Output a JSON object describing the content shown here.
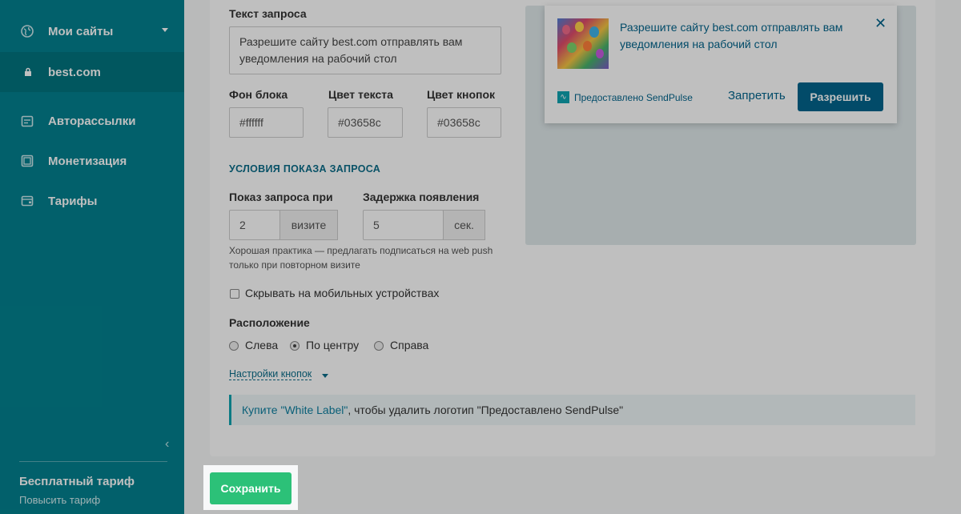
{
  "sidebar": {
    "items": [
      {
        "label": "Мои сайты",
        "icon": "globe-icon"
      },
      {
        "label": "best.com",
        "icon": "lock-icon"
      },
      {
        "label": "Авторассылки",
        "icon": "calendar-icon"
      },
      {
        "label": "Монетизация",
        "icon": "monitor-icon"
      },
      {
        "label": "Тарифы",
        "icon": "wallet-icon"
      }
    ],
    "plan_name": "Бесплатный тариф",
    "upgrade_link": "Повысить тариф"
  },
  "form": {
    "request_text_label": "Текст запроса",
    "request_text_value": "Разрешите сайту best.com отправлять вам уведомления на рабочий стол",
    "bg_label": "Фон блока",
    "bg_value": "#ffffff",
    "text_color_label": "Цвет текста",
    "text_color_value": "#03658c",
    "button_color_label": "Цвет кнопок",
    "button_color_value": "#03658c",
    "conditions_title": "УСЛОВИЯ ПОКАЗА ЗАПРОСА",
    "show_at_label": "Показ запроса при",
    "show_at_value": "2",
    "show_at_unit": "визите",
    "delay_label": "Задержка появления",
    "delay_value": "5",
    "delay_unit": "сек.",
    "hint": "Хорошая практика — предлагать подписаться на web push только при повторном визите",
    "hide_mobile_label": "Скрывать на мобильных устройствах",
    "position_label": "Расположение",
    "position_options": [
      "Слева",
      "По центру",
      "Справа"
    ],
    "position_selected": "По центру",
    "button_settings_link": "Настройки кнопок",
    "note_link": "Купите \"White Label\"",
    "note_text": ", чтобы удалить логотип \"Предоставлено SendPulse\""
  },
  "preview": {
    "message": "Разрешите сайту best.com отправлять вам уведомления на рабочий стол",
    "branding": "Предоставлено SendPulse",
    "deny_label": "Запретить",
    "allow_label": "Разрешить"
  },
  "footer": {
    "save_label": "Сохранить"
  },
  "colors": {
    "sidebar": "#03818f",
    "accent": "#03658c",
    "save": "#2cc178"
  }
}
